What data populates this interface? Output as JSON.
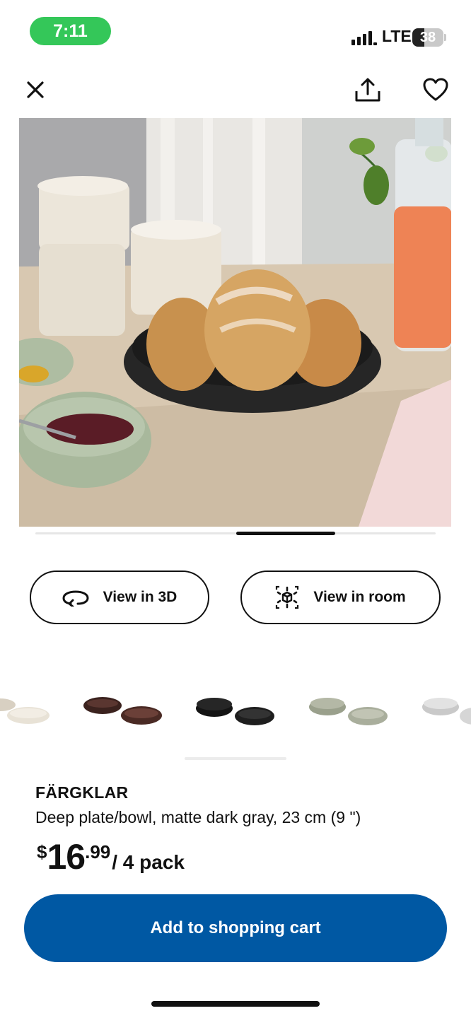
{
  "status_bar": {
    "time": "7:11",
    "network": "LTE",
    "battery_level": "38",
    "battery_fraction": 0.38,
    "time_pill_color": "#34c759"
  },
  "top_bar": {
    "icons": [
      "close-icon",
      "share-icon",
      "heart-icon"
    ]
  },
  "gallery": {
    "image_description_icon": "product-photo",
    "position_fraction": 0.56
  },
  "view_buttons": {
    "view_3d_label": "View in 3D",
    "view_room_label": "View in room"
  },
  "variants": {
    "colors": [
      "#e8e2d6",
      "#4a2a24",
      "#1e1e1e",
      "#a9ae9c",
      "#d6d6d6"
    ]
  },
  "product": {
    "name": "FÄRGKLAR",
    "description": "Deep plate/bowl, matte dark gray, 23 cm (9 \")",
    "price_currency": "$",
    "price_integer": "16",
    "price_decimal": ".99",
    "price_unit": "/ 4 pack"
  },
  "cart": {
    "label": "Add to shopping cart",
    "color": "#0058a3"
  }
}
